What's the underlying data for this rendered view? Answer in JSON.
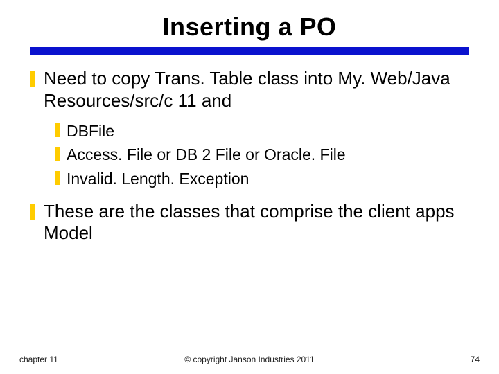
{
  "title": "Inserting a PO",
  "bullets": [
    {
      "text": "Need to copy Trans. Table class into My. Web/Java Resources/src/c 11 and",
      "sub": [
        "DBFile",
        "Access. File or DB 2 File or Oracle. File",
        "Invalid. Length. Exception"
      ]
    },
    {
      "text": "These are the classes that comprise the client apps Model",
      "sub": []
    }
  ],
  "footer": {
    "left": "chapter 11",
    "center": "© copyright Janson Industries 2011",
    "right": "74"
  }
}
